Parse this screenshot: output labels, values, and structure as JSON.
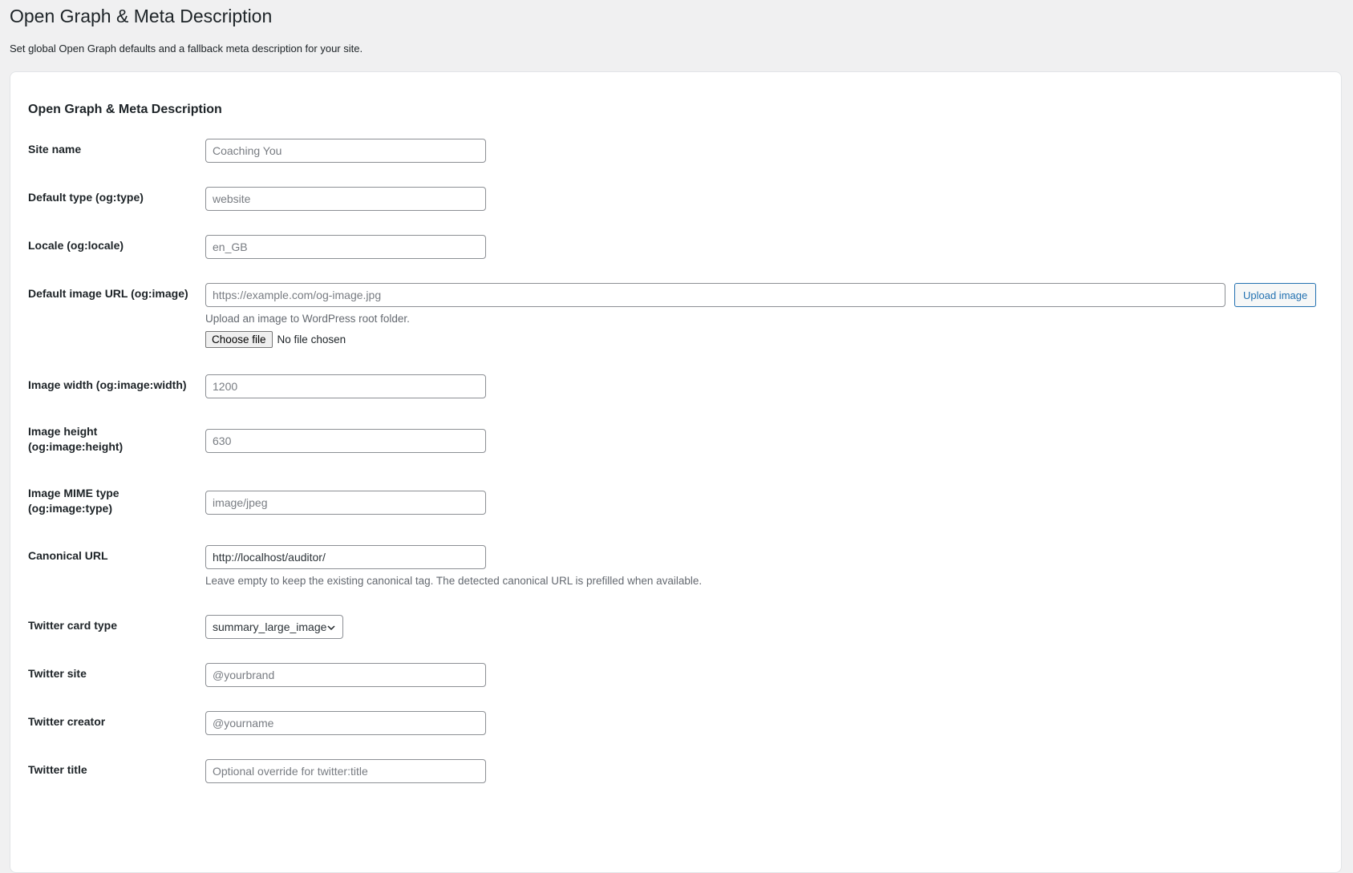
{
  "page": {
    "title": "Open Graph & Meta Description",
    "description": "Set global Open Graph defaults and a fallback meta description for your site."
  },
  "card": {
    "title": "Open Graph & Meta Description"
  },
  "fields": {
    "site_name": {
      "label": "Site name",
      "value": "",
      "placeholder": "Coaching You"
    },
    "og_type": {
      "label": "Default type (og:type)",
      "value": "",
      "placeholder": "website"
    },
    "og_locale": {
      "label": "Locale (og:locale)",
      "value": "",
      "placeholder": "en_GB"
    },
    "og_image": {
      "label": "Default image URL (og:image)",
      "value": "",
      "placeholder": "https://example.com/og-image.jpg",
      "upload_button": "Upload image",
      "help": "Upload an image to WordPress root folder.",
      "choose_file": "Choose file",
      "file_status": "No file chosen"
    },
    "og_image_width": {
      "label": "Image width (og:image:width)",
      "value": "",
      "placeholder": "1200"
    },
    "og_image_height": {
      "label_line1": "Image height",
      "label_line2": "(og:image:height)",
      "value": "",
      "placeholder": "630"
    },
    "og_image_type": {
      "label_line1": "Image MIME type",
      "label_line2": "(og:image:type)",
      "value": "",
      "placeholder": "image/jpeg"
    },
    "canonical_url": {
      "label": "Canonical URL",
      "value": "http://localhost/auditor/",
      "placeholder": "",
      "help": "Leave empty to keep the existing canonical tag. The detected canonical URL is prefilled when available."
    },
    "twitter_card": {
      "label": "Twitter card type",
      "selected": "summary_large_image"
    },
    "twitter_site": {
      "label": "Twitter site",
      "value": "",
      "placeholder": "@yourbrand"
    },
    "twitter_creator": {
      "label": "Twitter creator",
      "value": "",
      "placeholder": "@yourname"
    },
    "twitter_title": {
      "label": "Twitter title",
      "value": "",
      "placeholder": "Optional override for twitter:title"
    }
  },
  "icons": {
    "select_chevron": "chevron-down-icon"
  }
}
